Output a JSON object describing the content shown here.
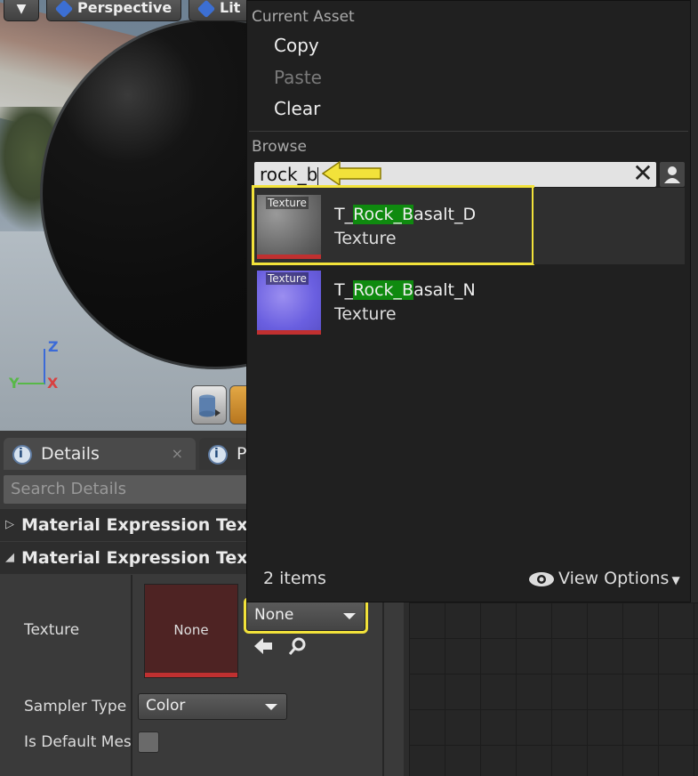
{
  "viewport": {
    "perspective_label": "Perspective",
    "lit_label": "Lit",
    "axis_z": "Z",
    "axis_y": "Y",
    "axis_x": "X"
  },
  "details": {
    "tab_details": "Details",
    "tab_close": "×",
    "tab_other": "P",
    "search_placeholder": "Search Details",
    "category1": "Material Expression Textu",
    "category2": "Material Expression Textu",
    "texture_label": "Texture",
    "texture_thumb_text": "None",
    "texture_combo_value": "None",
    "sampler_label": "Sampler Type",
    "sampler_value": "Color",
    "is_default_label": "Is Default Mes"
  },
  "menu": {
    "current_asset_header": "Current Asset",
    "copy": "Copy",
    "paste": "Paste",
    "clear": "Clear",
    "browse_header": "Browse",
    "search_value": "rock_b",
    "items_count": "2 items",
    "view_options": "View Options",
    "assets": [
      {
        "prefix": "T_",
        "match1": "Rock_",
        "match2": "B",
        "suffix": "asalt_D",
        "type": "Texture",
        "thumb_tag": "Texture"
      },
      {
        "prefix": "T_",
        "match1": "Rock_",
        "match2": "B",
        "suffix": "asalt_N",
        "type": "Texture",
        "thumb_tag": "Texture"
      }
    ]
  },
  "colors": {
    "highlight_outline": "#f2e23a",
    "match_highlight": "#0f8a0f",
    "texture_thumb_bg": "#4e2323"
  }
}
